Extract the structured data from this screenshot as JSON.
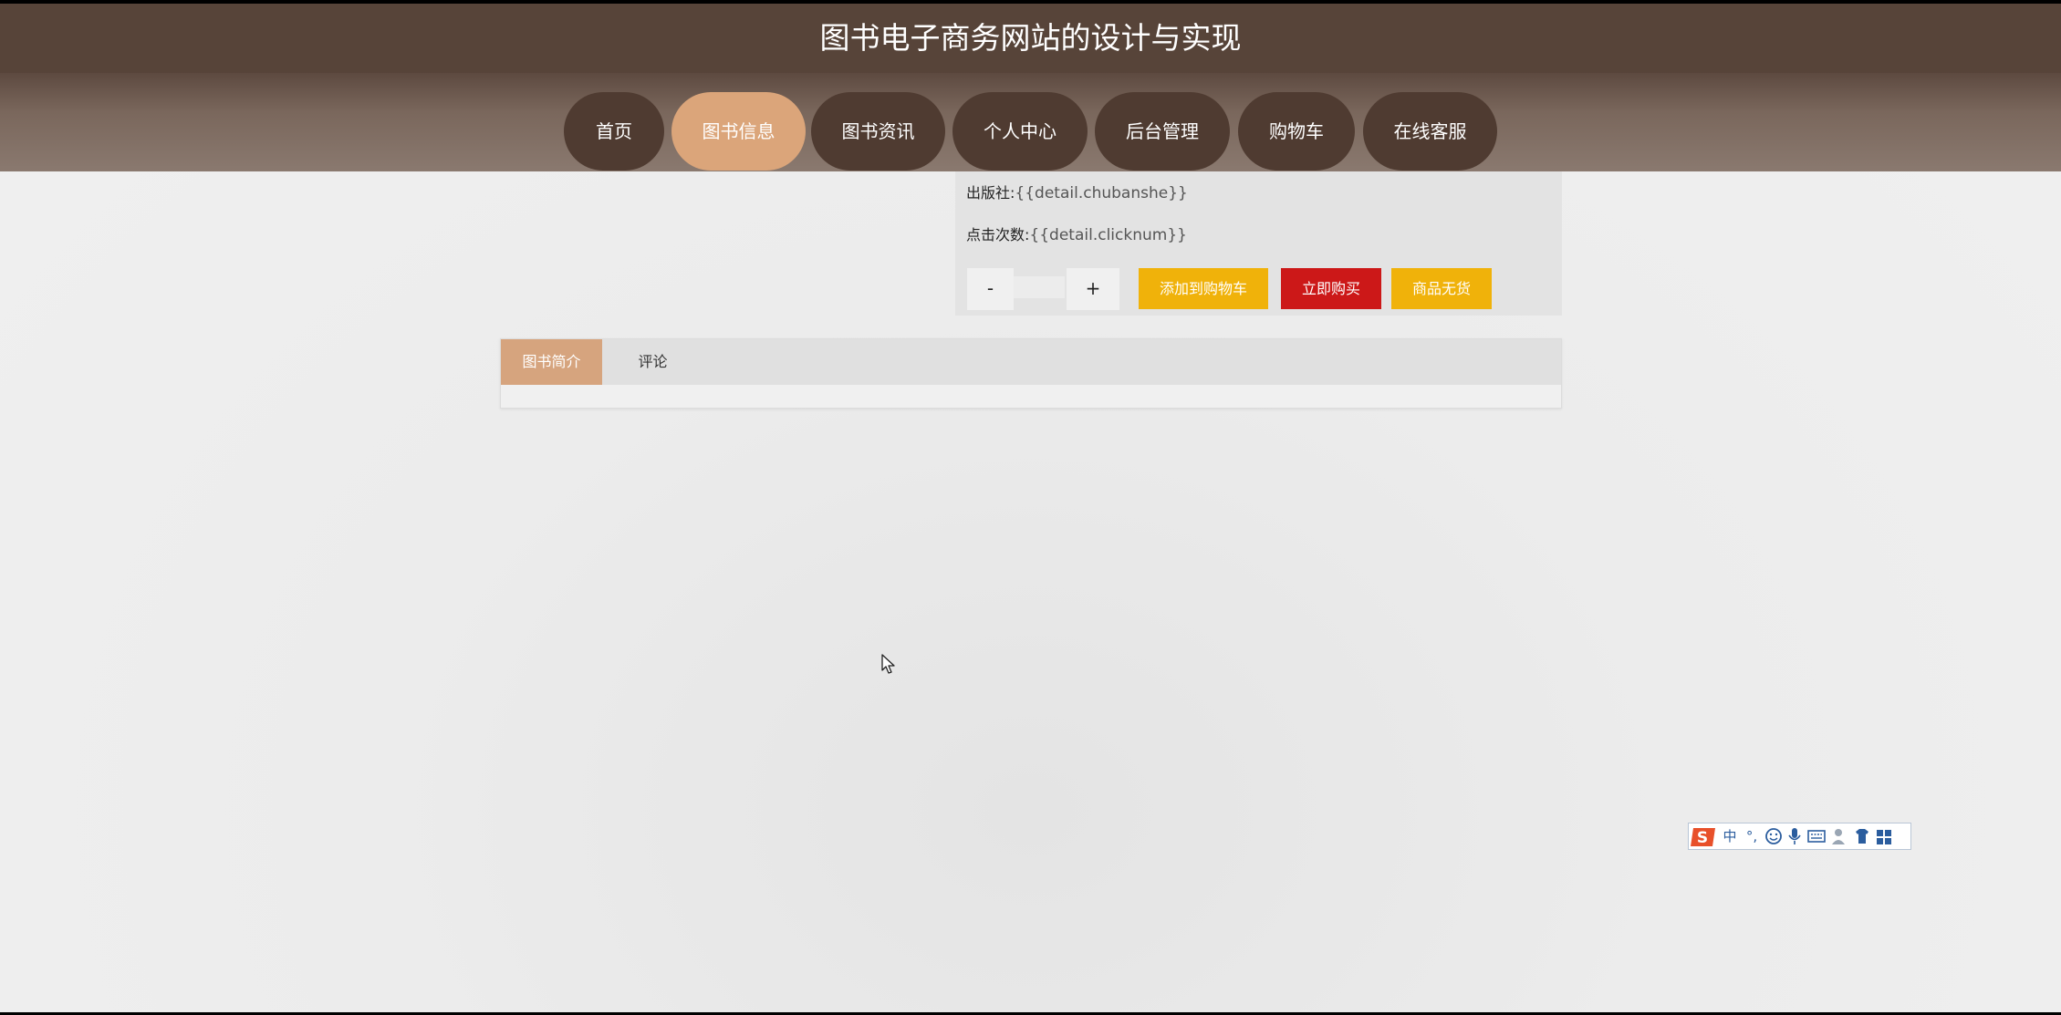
{
  "header": {
    "title": "图书电子商务网站的设计与实现"
  },
  "nav": {
    "items": [
      {
        "label": "首页"
      },
      {
        "label": "图书信息"
      },
      {
        "label": "图书资讯"
      },
      {
        "label": "个人中心"
      },
      {
        "label": "后台管理"
      },
      {
        "label": "购物车"
      },
      {
        "label": "在线客服"
      }
    ],
    "active": "图书信息"
  },
  "detail": {
    "publisher_label": "出版社:",
    "publisher_value": "{{detail.chubanshe}}",
    "clicks_label": "点击次数:",
    "clicks_value": "{{detail.clicknum}}",
    "quantity_value": "",
    "minus_label": "-",
    "plus_label": "+",
    "add_to_cart_label": "添加到购物车",
    "buy_now_label": "立即购买",
    "out_of_stock_label": "商品无货"
  },
  "tabs": {
    "items": [
      {
        "label": "图书简介"
      },
      {
        "label": "评论"
      }
    ],
    "active": "图书简介"
  },
  "colors": {
    "header_bg": "#574439",
    "nav_item_bg": "#4f3b31",
    "nav_active_bg": "#dba57a",
    "add_to_cart_bg": "#f0b20a",
    "buy_now_bg": "#cc1818",
    "out_of_stock_bg": "#f0b20a",
    "tab_active_bg": "#d6a47e"
  },
  "ime_toolbar": {
    "logo_icon": "sogou-s-icon",
    "mode_text": "中",
    "icons": [
      "punctuation-icon",
      "emoji-icon",
      "microphone-icon",
      "keyboard-icon",
      "user-icon",
      "skin-icon",
      "toolbox-icon"
    ]
  }
}
